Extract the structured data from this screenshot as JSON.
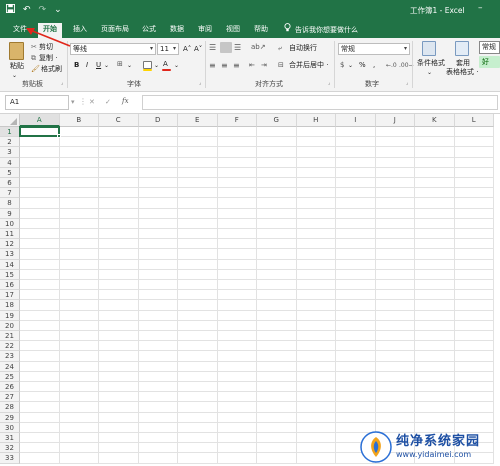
{
  "window": {
    "title": "工作簿1 - Excel",
    "min": "–"
  },
  "qat": {
    "save": "💾",
    "undo": "↶",
    "redo": "↷",
    "more": "⌄"
  },
  "tabs": [
    {
      "label": "文件"
    },
    {
      "label": "开始"
    },
    {
      "label": "插入"
    },
    {
      "label": "页面布局"
    },
    {
      "label": "公式"
    },
    {
      "label": "数据"
    },
    {
      "label": "审阅"
    },
    {
      "label": "视图"
    },
    {
      "label": "帮助"
    }
  ],
  "tell_me": "告诉我你想要做什么",
  "ribbon": {
    "paste": "粘贴",
    "cut": "剪切",
    "copy": "复制 ·",
    "format_painter": "格式刷",
    "clipboard": "剪贴板",
    "font_name": "等线",
    "font_size": "11",
    "grow": "A˄",
    "shrink": "A˅",
    "bold": "B",
    "italic": "I",
    "underline": "U",
    "font_group": "字体",
    "wrap": "自动换行",
    "merge": "合并后居中 ·",
    "align_group": "对齐方式",
    "number_format": "常规",
    "percent": "%",
    "comma": ",",
    "number_group": "数字",
    "cond_format": "条件格式",
    "table_format_1": "套用",
    "table_format_2": "表格格式 ·",
    "style_normal": "常规",
    "style_good": "好"
  },
  "formula_bar": {
    "name_box": "A1",
    "cancel": "✕",
    "enter": "✓",
    "fx": "fx",
    "value": ""
  },
  "grid": {
    "columns": [
      "A",
      "B",
      "C",
      "D",
      "E",
      "F",
      "G",
      "H",
      "I",
      "J",
      "K",
      "L"
    ],
    "rows": [
      "1",
      "2",
      "3",
      "4",
      "5",
      "6",
      "7",
      "8",
      "9",
      "10",
      "11",
      "12",
      "13",
      "14",
      "15",
      "16",
      "17",
      "18",
      "19",
      "20",
      "21",
      "22",
      "23",
      "24",
      "25",
      "26",
      "27",
      "28",
      "29",
      "30",
      "31",
      "32",
      "33"
    ],
    "selected_cell": "A1"
  },
  "watermark": {
    "site_name": "纯净系统家园",
    "site_url": "www.yidaimei.com"
  },
  "colors": {
    "excel_green": "#217346",
    "arrow_red": "#e0261b",
    "selection": "#217346"
  }
}
